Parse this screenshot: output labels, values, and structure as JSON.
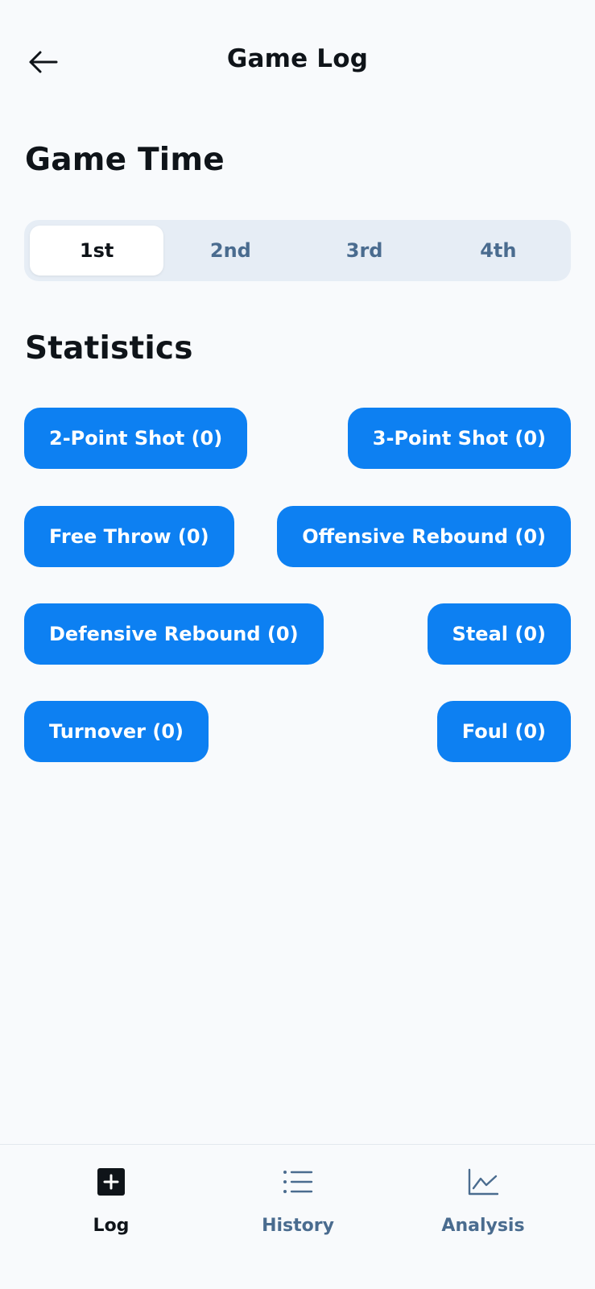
{
  "header": {
    "title": "Game Log"
  },
  "game_time": {
    "title": "Game Time",
    "periods": [
      "1st",
      "2nd",
      "3rd",
      "4th"
    ],
    "selected": "1st"
  },
  "statistics": {
    "title": "Statistics",
    "buttons": [
      "2-Point Shot (0)",
      "3-Point Shot (0)",
      "Free Throw (0)",
      "Offensive Rebound (0)",
      "Defensive Rebound (0)",
      "Steal (0)",
      "Turnover (0)",
      "Foul (0)"
    ]
  },
  "bottom_nav": {
    "items": [
      {
        "label": "Log",
        "icon": "plus-square-icon",
        "active": true
      },
      {
        "label": "History",
        "icon": "list-icon",
        "active": false
      },
      {
        "label": "Analysis",
        "icon": "line-chart-icon",
        "active": false
      }
    ]
  },
  "colors": {
    "accent": "#0d80f2",
    "muted_text": "#4a6c8f",
    "background": "#f8fafc",
    "segment_bg": "#e6edf5"
  }
}
